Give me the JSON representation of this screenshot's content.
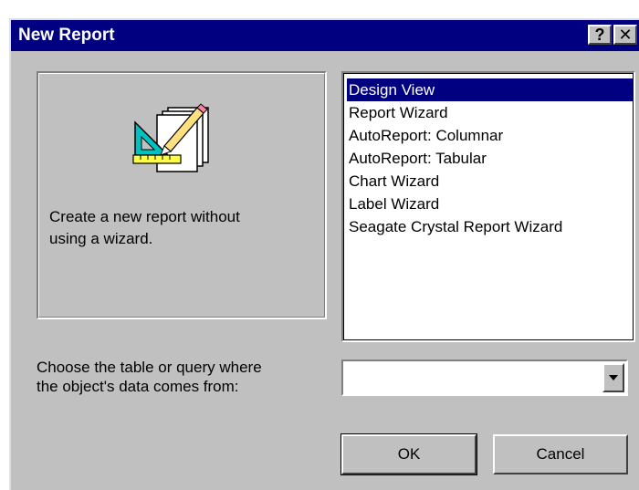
{
  "window": {
    "title": "New Report",
    "help_glyph": "?",
    "close_glyph": "✕"
  },
  "preview": {
    "icon": "report-design-icon",
    "description": "Create a new report without\nusing a wizard."
  },
  "report_types": {
    "selected": "Design View",
    "items": [
      "Design View",
      "Report Wizard",
      "AutoReport:  Columnar",
      "AutoReport:  Tabular",
      "Chart Wizard",
      "Label Wizard",
      "Seagate Crystal Report Wizard"
    ]
  },
  "source": {
    "label": "Choose the table or query where\nthe object's data comes from:",
    "value": ""
  },
  "buttons": {
    "ok": "OK",
    "cancel": "Cancel"
  },
  "colors": {
    "titlebar": "#000080",
    "face": "#c0c0c0",
    "selection": "#000080"
  }
}
